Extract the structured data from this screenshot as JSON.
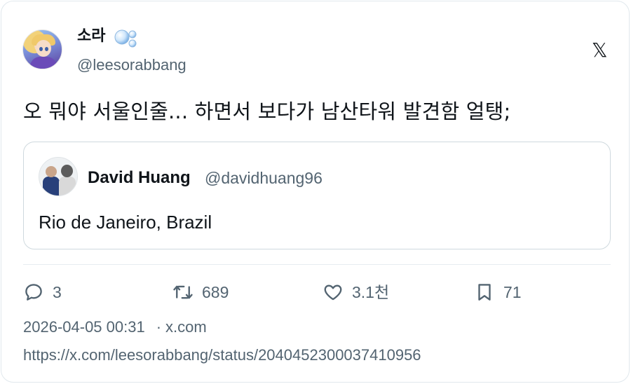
{
  "author": {
    "display_name": "소라",
    "handle": "@leesorabbang",
    "avatar_icon": "anime-girl-avatar"
  },
  "brand": {
    "logo": "x-logo"
  },
  "tweet": {
    "text": "오 뭐야 서울인줄... 하면서 보다가 남산타워 발견함 얼탱;"
  },
  "quoted_tweet": {
    "author_name": "David Huang",
    "author_handle": "@davidhuang96",
    "text": "Rio de Janeiro, Brazil",
    "avatar_icon": "two-people-avatar"
  },
  "actions": {
    "reply_count": "3",
    "retweet_count": "689",
    "like_count": "3.1천",
    "bookmark_count": "71"
  },
  "meta": {
    "timestamp": "2026-04-05 00:31",
    "separator": "·",
    "source": "x.com",
    "url": "https://x.com/leesorabbang/status/2040452300037410956"
  },
  "colors": {
    "text_primary": "#0f1419",
    "text_secondary": "#536471",
    "border": "#cfd9de"
  }
}
